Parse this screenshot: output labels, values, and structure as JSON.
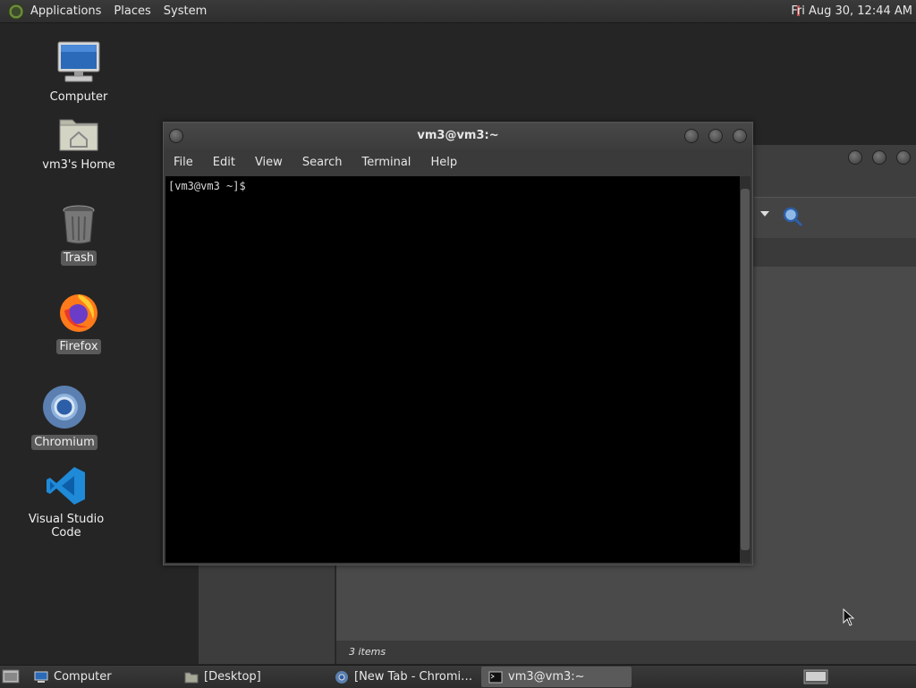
{
  "top_panel": {
    "menus": [
      "Applications",
      "Places",
      "System"
    ],
    "clock": "Fri Aug 30, 12:44 AM"
  },
  "desktop_icons": [
    {
      "label": "Computer",
      "icon": "computer-icon",
      "selected": false
    },
    {
      "label": "vm3's Home",
      "icon": "home-folder-icon",
      "selected": false
    },
    {
      "label": "Trash",
      "icon": "trash-icon",
      "selected": true
    },
    {
      "label": "Firefox",
      "icon": "firefox-icon",
      "selected": true
    },
    {
      "label": "Chromium",
      "icon": "chromium-icon",
      "selected": true
    },
    {
      "label": "Visual Studio Code",
      "icon": "vscode-icon",
      "selected": false
    }
  ],
  "terminal": {
    "title": "vm3@vm3:~",
    "menus": [
      "File",
      "Edit",
      "View",
      "Search",
      "Terminal",
      "Help"
    ],
    "prompt": "[vm3@vm3 ~]$"
  },
  "file_manager": {
    "status": "3 items"
  },
  "taskbar": {
    "items": [
      {
        "label": "Computer",
        "icon": "computer-icon"
      },
      {
        "label": "[Desktop]",
        "icon": "folder-icon"
      },
      {
        "label": "[New Tab - Chromi…",
        "icon": "chromium-icon"
      },
      {
        "label": "vm3@vm3:~",
        "icon": "terminal-icon",
        "active": true
      }
    ]
  }
}
